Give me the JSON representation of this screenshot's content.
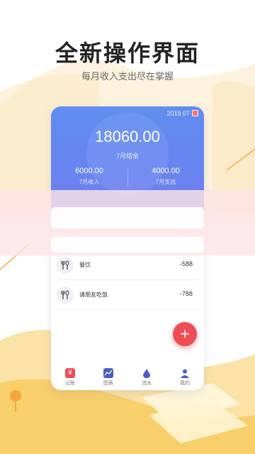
{
  "promo": {
    "headline": "全新操作界面",
    "subheadline": "每月收入支出尽在掌握"
  },
  "card": {
    "date": "2019.07",
    "balance": "18060.00",
    "balance_label": "7月结余",
    "income_amount": "6000.00",
    "income_label": "7月收入",
    "expense_amount": "4000.00",
    "expense_label": "7月支出"
  },
  "entries": [
    {
      "icon": "cutlery-icon",
      "name": "餐饮",
      "amount": "-588"
    },
    {
      "icon": "cutlery-icon",
      "name": "请朋友吃饭",
      "amount": "-788"
    }
  ],
  "tabs": [
    {
      "icon": "yen-icon",
      "label": "记账",
      "color": "#ef4d56"
    },
    {
      "icon": "chart-icon",
      "label": "图表",
      "color": "#4a5dbf"
    },
    {
      "icon": "drop-icon",
      "label": "流水",
      "color": "#4a5dbf"
    },
    {
      "icon": "user-icon",
      "label": "我的",
      "color": "#4a5dbf"
    }
  ],
  "colors": {
    "card_gradient_start": "#5f8df0",
    "card_gradient_end": "#6e7ff0",
    "fab": "#ef4d56",
    "accent_yellow": "#f8cf6a",
    "overlay_pink": "#fce4e6"
  }
}
